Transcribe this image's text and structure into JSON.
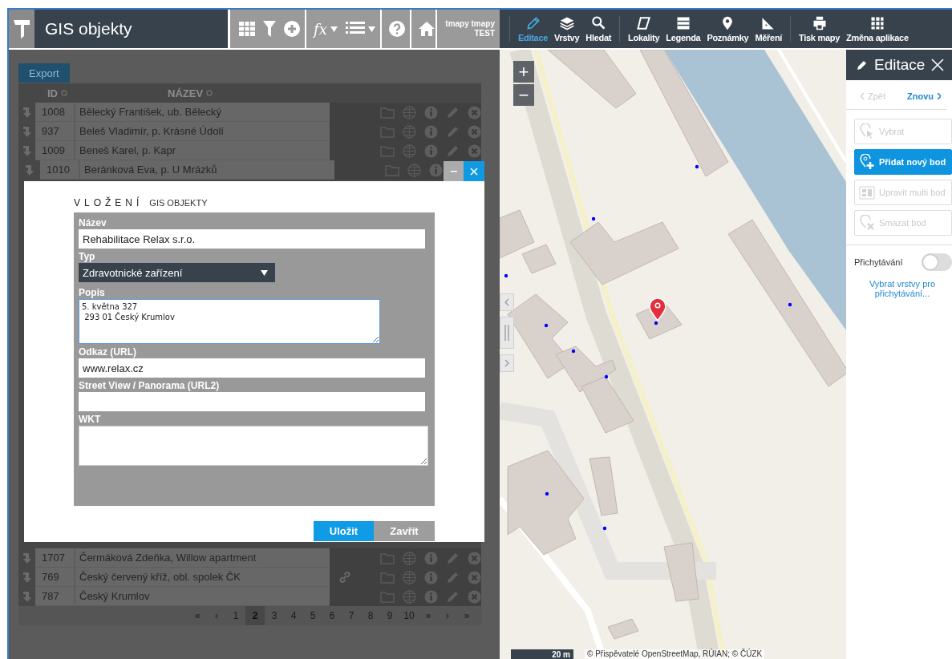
{
  "app_bar": {
    "title": "GIS objekty",
    "tools": [
      {
        "kind": "grid",
        "dropdown": false
      },
      {
        "kind": "filter",
        "dropdown": false
      },
      {
        "kind": "add",
        "dropdown": false
      },
      {
        "kind": "function",
        "label": "fx",
        "dropdown": true
      },
      {
        "kind": "list",
        "dropdown": true
      },
      {
        "kind": "help",
        "dropdown": false
      },
      {
        "kind": "home",
        "dropdown": false
      }
    ],
    "user_name": "tmapy tmapy",
    "user_env": "TEST"
  },
  "map_toolbar": [
    {
      "kind": "pencil",
      "label": "Editace",
      "selected": true
    },
    {
      "kind": "layers",
      "label": "Vrstvy",
      "selected": false
    },
    {
      "kind": "search",
      "label": "Hledat",
      "selected": false
    },
    {
      "kind": "polygon",
      "label": "Lokality",
      "selected": false
    },
    {
      "kind": "legend",
      "label": "Legenda",
      "selected": false
    },
    {
      "kind": "pin",
      "label": "Poznámky",
      "selected": false
    },
    {
      "kind": "ruler",
      "label": "Měření",
      "selected": false
    },
    {
      "kind": "printer",
      "label": "Tisk mapy",
      "selected": false
    },
    {
      "kind": "apps",
      "label": "Změna aplikace",
      "selected": false
    }
  ],
  "table": {
    "export": "Export",
    "columns": [
      "ID",
      "NÁZEV"
    ],
    "rows_top": [
      {
        "id": "1008",
        "name": "Bělecký František, ub. Bělecký",
        "link": false
      },
      {
        "id": "937",
        "name": "Beleš Vladimír, p. Krásné Údolí",
        "link": false
      },
      {
        "id": "1009",
        "name": "Beneš Karel, p. Kapr",
        "link": false
      },
      {
        "id": "1010",
        "name": "Beránková Eva, p. U Mrázků",
        "link": false
      }
    ],
    "rows_bottom": [
      {
        "id": "1707",
        "name": "Čermáková Zdeňka, Willow apartment",
        "link": false
      },
      {
        "id": "769",
        "name": "Český červený kříž, obl. spolek ČK",
        "link": true
      },
      {
        "id": "787",
        "name": "Český Krumlov",
        "link": false
      }
    ],
    "pager": [
      {
        "label": "«",
        "selected": false
      },
      {
        "label": "‹",
        "selected": false
      },
      {
        "label": "1",
        "selected": false
      },
      {
        "label": "2",
        "selected": true
      },
      {
        "label": "3",
        "selected": false
      },
      {
        "label": "4",
        "selected": false
      },
      {
        "label": "5",
        "selected": false
      },
      {
        "label": "6",
        "selected": false
      },
      {
        "label": "7",
        "selected": false
      },
      {
        "label": "8",
        "selected": false
      },
      {
        "label": "9",
        "selected": false
      },
      {
        "label": "10",
        "selected": false
      },
      {
        "label": "»",
        "selected": false
      },
      {
        "label": "›",
        "selected": false
      },
      {
        "label": "»",
        "selected": false
      }
    ]
  },
  "dialog": {
    "title": "VLOŽENÍ",
    "subtitle": "GIS OBJEKTY",
    "fields": [
      {
        "label": "Název",
        "kind": "text",
        "value": "Rehabilitace Relax s.r.o.",
        "focused": false
      },
      {
        "label": "Typ",
        "kind": "select",
        "value": "Zdravotnické zařízení",
        "focused": false
      },
      {
        "label": "Popis",
        "kind": "textarea",
        "value": "5. května 327\n 293 01 Český Krumlov",
        "focused": true
      },
      {
        "label": "Odkaz (URL)",
        "kind": "text",
        "value": "www.relax.cz",
        "focused": false
      },
      {
        "label": "Street View / Panorama (URL2)",
        "kind": "text",
        "focused": false
      },
      {
        "label": "WKT",
        "kind": "wide_textarea",
        "focused": false
      }
    ],
    "buttons": [
      {
        "label": "Uložit",
        "primary": true
      },
      {
        "label": "Zavřít",
        "primary": false
      }
    ]
  },
  "map": {
    "zoom": [
      "+",
      "−"
    ],
    "scale": "20 m",
    "attribution": "© Přispěvatelé OpenStreetMap, RÚIAN; © ČÚZK"
  },
  "edit_panel": {
    "title": "Editace",
    "undo": {
      "label": "Zpět",
      "disabled": true
    },
    "redo": {
      "label": "Znovu",
      "disabled": false
    },
    "tools": [
      {
        "kind": "select",
        "label": "Vybrat",
        "selected": false,
        "disabled": true
      },
      {
        "kind": "add",
        "label": "Přidat nový bod",
        "selected": true,
        "disabled": false
      },
      {
        "kind": "multi",
        "label": "Upravit multi bod",
        "selected": false,
        "disabled": true
      },
      {
        "kind": "delete",
        "label": "Smazat bod",
        "selected": false,
        "disabled": true
      }
    ],
    "snapping": {
      "label": "Přichytávání",
      "on": false
    },
    "snap_link": "Vybrat vrstvy pro přichytávání..."
  }
}
